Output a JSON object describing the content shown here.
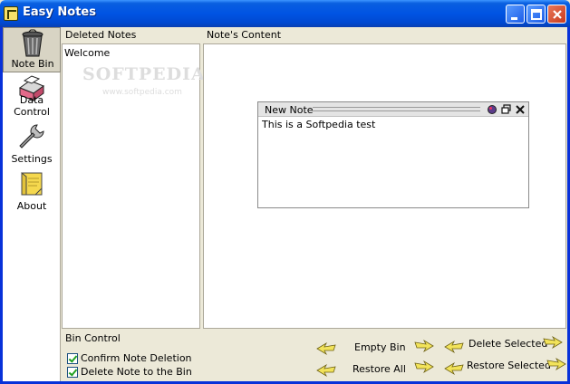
{
  "window": {
    "title": "Easy Notes"
  },
  "nav": {
    "items": [
      {
        "label": "Note Bin",
        "icon": "trash-bin-icon",
        "active": true
      },
      {
        "label": "Data Control",
        "icon": "database-icon",
        "active": false
      },
      {
        "label": "Settings",
        "icon": "wrench-icon",
        "active": false
      },
      {
        "label": "About",
        "icon": "sticky-note-icon",
        "active": false
      }
    ]
  },
  "deleted_notes": {
    "header": "Deleted Notes",
    "items": [
      "Welcome"
    ],
    "watermark": "SOFTPEDIA",
    "watermark_url": "www.softpedia.com"
  },
  "content": {
    "header": "Note's Content",
    "note": {
      "title": "New Note",
      "body": "This is a Softpedia test"
    }
  },
  "bin_control": {
    "header": "Bin Control",
    "confirm_deletion": {
      "label": "Confirm Note Deletion",
      "checked": true
    },
    "delete_to_bin": {
      "label": "Delete Note to the Bin",
      "checked": true
    }
  },
  "actions": {
    "empty_bin": "Empty Bin",
    "restore_all": "Restore All",
    "delete_selected": "Delete Selected",
    "restore_selected": "Restore Selected"
  },
  "colors": {
    "titlebar": "#0054e3",
    "frame": "#0831d9",
    "background": "#ece9d8",
    "arrow": "#f2e35a"
  }
}
